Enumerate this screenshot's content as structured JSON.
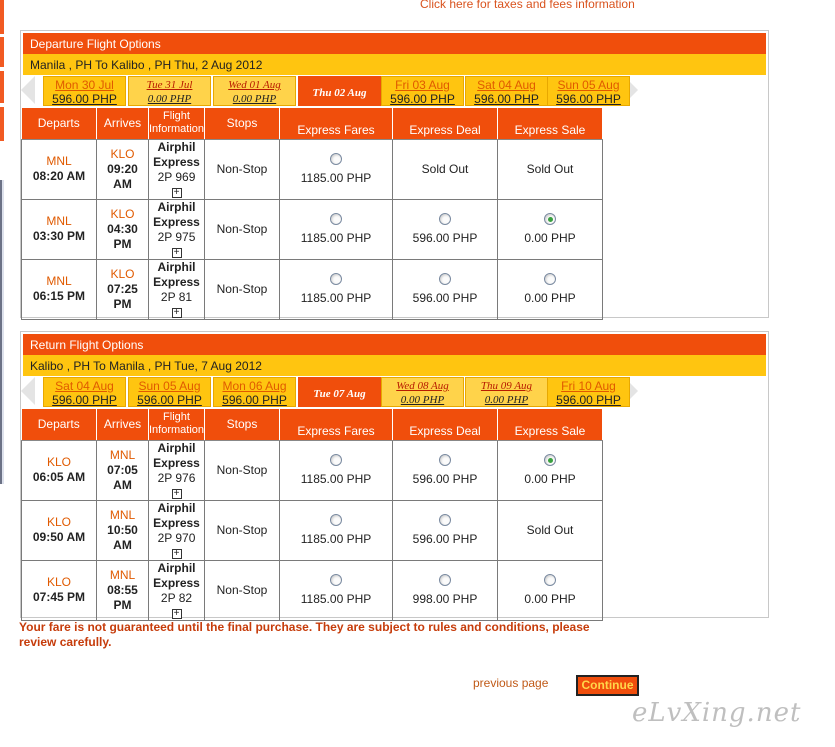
{
  "top_link": "Click here for taxes and fees information",
  "departure": {
    "title": "Departure Flight Options",
    "route": "Manila , PH To Kalibo , PH Thu, 2 Aug 2012",
    "tabs": [
      {
        "day": "Mon 30 Jul",
        "price": "596.00 PHP",
        "state": "normal"
      },
      {
        "day": "Tue 31 Jul",
        "price": "0.00 PHP",
        "state": "unavail"
      },
      {
        "day": "Wed 01 Aug",
        "price": "0.00 PHP",
        "state": "unavail"
      },
      {
        "day": "Thu 02 Aug",
        "price": "",
        "state": "selected"
      },
      {
        "day": "Fri 03 Aug",
        "price": "596.00 PHP",
        "state": "normal"
      },
      {
        "day": "Sat 04 Aug",
        "price": "596.00 PHP",
        "state": "normal"
      },
      {
        "day": "Sun 05 Aug",
        "price": "596.00 PHP",
        "state": "normal"
      }
    ],
    "rows": [
      {
        "dep_code": "MNL",
        "dep_time": "08:20 AM",
        "arr_code": "KLO",
        "arr_time": "09:20 AM",
        "airline": "Airphil Express",
        "flight": "2P  969",
        "stops": "Non-Stop",
        "fares": [
          {
            "price": "1185.00 PHP",
            "radio": true,
            "checked": false
          },
          {
            "price": "Sold Out",
            "radio": false,
            "checked": false
          },
          {
            "price": "Sold Out",
            "radio": false,
            "checked": false
          }
        ]
      },
      {
        "dep_code": "MNL",
        "dep_time": "03:30 PM",
        "arr_code": "KLO",
        "arr_time": "04:30 PM",
        "airline": "Airphil Express",
        "flight": "2P  975",
        "stops": "Non-Stop",
        "fares": [
          {
            "price": "1185.00 PHP",
            "radio": true,
            "checked": false
          },
          {
            "price": "596.00 PHP",
            "radio": true,
            "checked": false
          },
          {
            "price": "0.00 PHP",
            "radio": true,
            "checked": true
          }
        ]
      },
      {
        "dep_code": "MNL",
        "dep_time": "06:15 PM",
        "arr_code": "KLO",
        "arr_time": "07:25 PM",
        "airline": "Airphil Express",
        "flight": "2P  81",
        "stops": "Non-Stop",
        "fares": [
          {
            "price": "1185.00 PHP",
            "radio": true,
            "checked": false
          },
          {
            "price": "596.00 PHP",
            "radio": true,
            "checked": false
          },
          {
            "price": "0.00 PHP",
            "radio": true,
            "checked": false
          }
        ]
      }
    ]
  },
  "return": {
    "title": "Return Flight Options",
    "route": "Kalibo , PH To Manila , PH Tue, 7 Aug 2012",
    "tabs": [
      {
        "day": "Sat 04 Aug",
        "price": "596.00 PHP",
        "state": "normal"
      },
      {
        "day": "Sun 05 Aug",
        "price": "596.00 PHP",
        "state": "normal"
      },
      {
        "day": "Mon 06 Aug",
        "price": "596.00 PHP",
        "state": "normal"
      },
      {
        "day": "Tue 07 Aug",
        "price": "",
        "state": "selected"
      },
      {
        "day": "Wed 08 Aug",
        "price": "0.00 PHP",
        "state": "unavail"
      },
      {
        "day": "Thu 09 Aug",
        "price": "0.00 PHP",
        "state": "unavail"
      },
      {
        "day": "Fri 10 Aug",
        "price": "596.00 PHP",
        "state": "normal"
      }
    ],
    "rows": [
      {
        "dep_code": "KLO",
        "dep_time": "06:05 AM",
        "arr_code": "MNL",
        "arr_time": "07:05 AM",
        "airline": "Airphil Express",
        "flight": "2P  976",
        "stops": "Non-Stop",
        "fares": [
          {
            "price": "1185.00 PHP",
            "radio": true,
            "checked": false
          },
          {
            "price": "596.00 PHP",
            "radio": true,
            "checked": false
          },
          {
            "price": "0.00 PHP",
            "radio": true,
            "checked": true
          }
        ]
      },
      {
        "dep_code": "KLO",
        "dep_time": "09:50 AM",
        "arr_code": "MNL",
        "arr_time": "10:50 AM",
        "airline": "Airphil Express",
        "flight": "2P  970",
        "stops": "Non-Stop",
        "fares": [
          {
            "price": "1185.00 PHP",
            "radio": true,
            "checked": false
          },
          {
            "price": "596.00 PHP",
            "radio": true,
            "checked": false
          },
          {
            "price": "Sold Out",
            "radio": false,
            "checked": false
          }
        ]
      },
      {
        "dep_code": "KLO",
        "dep_time": "07:45 PM",
        "arr_code": "MNL",
        "arr_time": "08:55 PM",
        "airline": "Airphil Express",
        "flight": "2P  82",
        "stops": "Non-Stop",
        "fares": [
          {
            "price": "1185.00 PHP",
            "radio": true,
            "checked": false
          },
          {
            "price": "998.00 PHP",
            "radio": true,
            "checked": false
          },
          {
            "price": "0.00 PHP",
            "radio": true,
            "checked": false
          }
        ]
      }
    ]
  },
  "columns": {
    "departs": "Departs",
    "arrives": "Arrives",
    "flight_info_1": "Flight",
    "flight_info_2": "Information",
    "stops": "Stops",
    "express_fares": "Express Fares",
    "express_deal": "Express Deal",
    "express_sale": "Express Sale"
  },
  "disclaimer": "Your fare is not guaranteed until the final purchase. They are subject to rules and conditions, please review carefully.",
  "previous_page": "previous page",
  "continue_label": "Continue",
  "watermark": "eLvXing.net",
  "colors": {
    "header_orange": "#f04e0c",
    "tab_yellow": "#ffc510",
    "link_orange": "#e05a00"
  }
}
